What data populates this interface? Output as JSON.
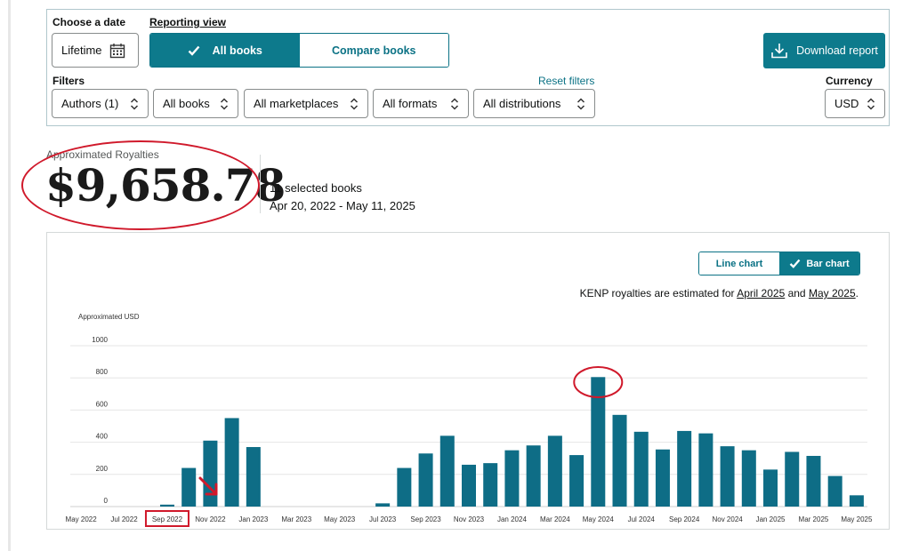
{
  "filters_panel": {
    "choose_date_label": "Choose a date",
    "date_value": "Lifetime",
    "reporting_view_label": "Reporting view",
    "view_options": [
      "All books",
      "Compare books"
    ],
    "download_label": "Download report",
    "filters_label": "Filters",
    "reset_label": "Reset filters",
    "filter_values": {
      "authors": "Authors (1)",
      "books": "All books",
      "marketplaces": "All marketplaces",
      "formats": "All formats",
      "distributions": "All distributions"
    },
    "currency_label": "Currency",
    "currency_value": "USD"
  },
  "summary": {
    "label": "Approximated Royalties",
    "total": "$9,658.78",
    "books_count": "11 selected books",
    "date_range": "Apr 20, 2022 - May 11, 2025"
  },
  "chart_controls": {
    "line_label": "Line chart",
    "bar_label": "Bar chart",
    "note_prefix": "KENP royalties are estimated for ",
    "note_month1": "April 2025",
    "note_and": " and ",
    "note_month2": "May 2025",
    "note_end": "."
  },
  "colors": {
    "accent": "#0d7a8c",
    "bar": "#0e6d86",
    "annotation": "#d0192b"
  },
  "icons": [
    "calendar-icon",
    "check-icon",
    "download-icon",
    "chevron-updown-icon",
    "annotation-arrow-icon"
  ],
  "chart_data": {
    "type": "bar",
    "ylabel": "Approximated USD",
    "ylim": [
      0,
      1000
    ],
    "yticks": [
      0,
      200,
      400,
      600,
      800,
      1000
    ],
    "grid": true,
    "x": [
      "May 2022",
      "Jun 2022",
      "Jul 2022",
      "Aug 2022",
      "Sep 2022",
      "Oct 2022",
      "Nov 2022",
      "Dec 2022",
      "Jan 2023",
      "Feb 2023",
      "Mar 2023",
      "Apr 2023",
      "May 2023",
      "Jun 2023",
      "Jul 2023",
      "Aug 2023",
      "Sep 2023",
      "Oct 2023",
      "Nov 2023",
      "Dec 2023",
      "Jan 2024",
      "Feb 2024",
      "Mar 2024",
      "Apr 2024",
      "May 2024",
      "Jun 2024",
      "Jul 2024",
      "Aug 2024",
      "Sep 2024",
      "Oct 2024",
      "Nov 2024",
      "Dec 2024",
      "Jan 2025",
      "Feb 2025",
      "Mar 2025",
      "Apr 2025",
      "May 2025"
    ],
    "values": [
      0,
      0,
      0,
      0,
      12,
      240,
      410,
      550,
      370,
      0,
      0,
      0,
      0,
      0,
      20,
      240,
      330,
      440,
      260,
      270,
      350,
      380,
      440,
      320,
      805,
      570,
      465,
      355,
      470,
      455,
      375,
      350,
      230,
      340,
      315,
      190,
      70
    ],
    "xtick_labels": [
      "May 2022",
      "Jul 2022",
      "Sep 2022",
      "Nov 2022",
      "Jan 2023",
      "Mar 2023",
      "May 2023",
      "Jul 2023",
      "Sep 2023",
      "Nov 2023",
      "Jan 2024",
      "Mar 2024",
      "May 2024",
      "Jul 2024",
      "Sep 2024",
      "Nov 2024",
      "Jan 2025",
      "Mar 2025",
      "May 2025"
    ]
  }
}
